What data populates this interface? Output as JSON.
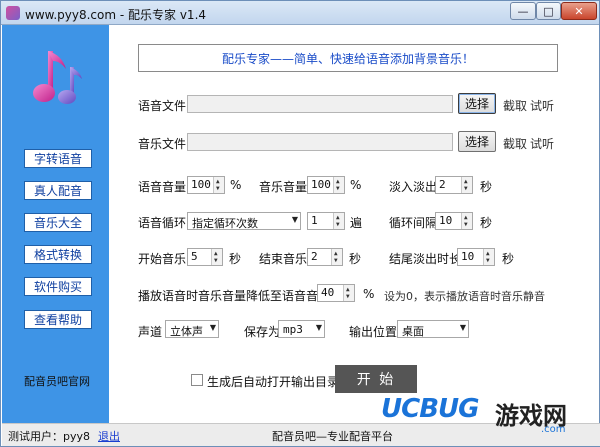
{
  "window": {
    "title": "www.pyy8.com - 配乐专家 v1.4",
    "controls": {
      "minimize": "—",
      "maximize": "□",
      "close": "✕"
    }
  },
  "sidebar": {
    "items": [
      {
        "label": "字转语音"
      },
      {
        "label": "真人配音"
      },
      {
        "label": "音乐大全"
      },
      {
        "label": "格式转换"
      },
      {
        "label": "软件购买"
      },
      {
        "label": "查看帮助"
      }
    ],
    "brand": "配音员吧官网"
  },
  "banner": "配乐专家——简单、快速给语音添加背景音乐！",
  "voice_file": {
    "label": "语音文件",
    "value": "",
    "button": "选择",
    "clip": "截取",
    "listen": "试听"
  },
  "music_file": {
    "label": "音乐文件",
    "value": "",
    "button": "选择",
    "clip": "截取",
    "listen": "试听"
  },
  "volume_row": {
    "voice_volume": {
      "label": "语音音量",
      "value": "100",
      "unit": "%"
    },
    "music_volume": {
      "label": "音乐音量",
      "value": "100",
      "unit": "%"
    },
    "fade": {
      "label": "淡入淡出",
      "value": "2",
      "unit": "秒"
    }
  },
  "loop_row": {
    "voice_loop": {
      "label": "语音循环",
      "selected": "指定循环次数",
      "count": "1",
      "unit": "遍"
    },
    "loop_interval": {
      "label": "循环间隔",
      "value": "10",
      "unit": "秒"
    }
  },
  "timing_row": {
    "start_music": {
      "label": "开始音乐",
      "value": "5",
      "unit": "秒"
    },
    "end_music": {
      "label": "结束音乐",
      "value": "2",
      "unit": "秒"
    },
    "tail_fade": {
      "label": "结尾淡出时长",
      "value": "10",
      "unit": "秒"
    }
  },
  "ducking": {
    "label": "播放语音时音乐音量降低至语音音量的",
    "value": "40",
    "unit": "%",
    "hint": "设为0，表示播放语音时音乐静音"
  },
  "output_row": {
    "channel": {
      "label": "声道",
      "selected": "立体声"
    },
    "save_as": {
      "label": "保存为",
      "selected": "mp3"
    },
    "output_location": {
      "label": "输出位置",
      "selected": "桌面"
    }
  },
  "auto_open": {
    "label": "生成后自动打开输出目录",
    "checked": false
  },
  "start_button": "开 始",
  "status_bar": {
    "user": "测试用户：pyy8",
    "exit": "退出",
    "platform": "配音员吧—专业配音平台"
  },
  "watermark": {
    "brand": "UCBUG",
    "cn": "游戏网",
    "url": ".com"
  },
  "colors": {
    "sidebar": "#3e94e6",
    "banner_text": "#1a4cc8",
    "start_button": "#555555"
  }
}
